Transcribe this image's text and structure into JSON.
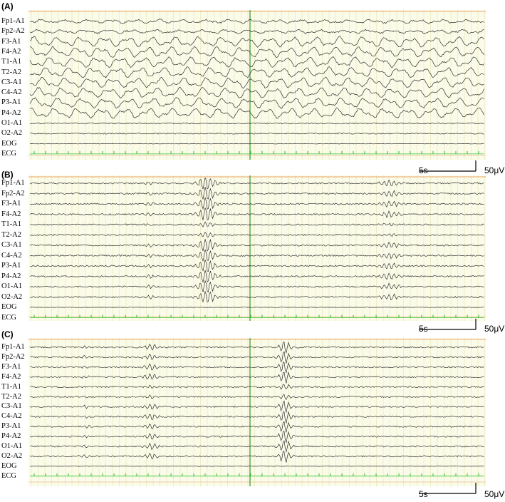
{
  "panels": [
    {
      "label": "(A)",
      "channels": [
        "Fp1-A1",
        "Fp2-A2",
        "F3-A1",
        "F4-A2",
        "T1-A1",
        "T2-A2",
        "C3-A1",
        "C4-A2",
        "P3-A1",
        "P4-A2",
        "O1-A1",
        "O2-A2",
        "EOG",
        "ECG"
      ],
      "scale_time": "5s",
      "scale_amplitude": "50μV"
    },
    {
      "label": "(B)",
      "channels": [
        "Fp1-A1",
        "Fp2-A2",
        "F3-A1",
        "F4-A2",
        "T1-A1",
        "T2-A2",
        "C3-A1",
        "C4-A2",
        "P3-A1",
        "P4-A2",
        "O1-A1",
        "O2-A2",
        "EOG",
        "ECG"
      ],
      "scale_time": "5s",
      "scale_amplitude": "50μV"
    },
    {
      "label": "(C)",
      "channels": [
        "Fp1-A1",
        "Fp2-A2",
        "F3-A1",
        "F4-A2",
        "T1-A1",
        "T2-A2",
        "C3-A1",
        "C4-A2",
        "P3-A1",
        "P4-A2",
        "O1-A1",
        "O2-A2",
        "EOG",
        "ECG"
      ],
      "scale_time": "5s",
      "scale_amplitude": "50μV"
    }
  ],
  "colors": {
    "background": "#fbfbe9",
    "grid": "#e4dfa8",
    "trace": "#303030",
    "ecg": "#2fc12f",
    "marker": "#2e9b2e",
    "top_rule": "#e9a46c"
  }
}
